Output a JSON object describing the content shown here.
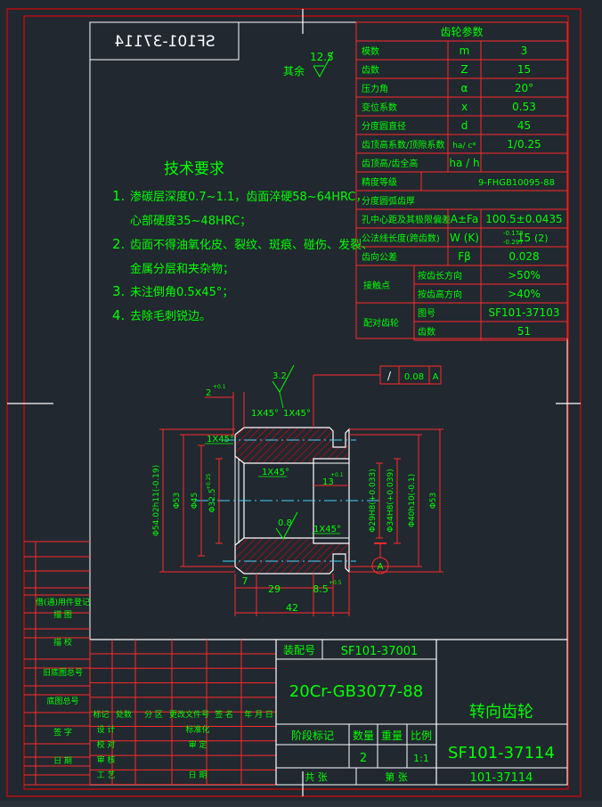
{
  "colors": {
    "background": "#212830",
    "border": "#ff0000",
    "line": "#ffffff",
    "text_green": "#00ff00",
    "table_red": "#ff2a2a",
    "center_line": "#3fd3ff",
    "hatch": "#ff0000"
  },
  "drawing_number_mirrored": "SF101-37114",
  "roughness": {
    "value": "12.5",
    "prefix": "其余"
  },
  "gear_table": {
    "title": "齿轮参数",
    "rows": [
      {
        "name": "模数",
        "sym": "m",
        "val": "3"
      },
      {
        "name": "齿数",
        "sym": "Z",
        "val": "15"
      },
      {
        "name": "压力角",
        "sym": "α",
        "val": "20°"
      },
      {
        "name": "变位系数",
        "sym": "x",
        "val": "0.53"
      },
      {
        "name": "分度圆直径",
        "sym": "d",
        "val": "45"
      },
      {
        "name": "齿顶高系数/顶隙系数",
        "sym": "ha/ c*",
        "val": "1/0.25"
      },
      {
        "name": "齿顶高/齿全高",
        "sym": "ha / h",
        "val": ""
      },
      {
        "name": "精度等级",
        "sym": "",
        "val": "9-FHGB10095-88"
      },
      {
        "name": "分度圆弧齿厚",
        "sym": "",
        "val": ""
      },
      {
        "name": "孔中心距及其极限偏差",
        "sym": "A±Fa",
        "val": "100.5±0.0435"
      },
      {
        "name": "公法线长度(跨齿数)",
        "sym": "W (K)",
        "val": "15"
      },
      {
        "name": "齿向公差",
        "sym": "Fβ",
        "val": "0.028"
      }
    ],
    "wk_tol_upper": "-0.178",
    "wk_tol_lower": "-0.297",
    "wk_k": "(2)",
    "contact_label": "接触点",
    "contact_rows": [
      {
        "name": "按齿长方向",
        "val": ">50%"
      },
      {
        "name": "按齿高方向",
        "val": ">40%"
      }
    ],
    "mate_label": "配对齿轮",
    "mate_rows": [
      {
        "name": "图号",
        "val": "SF101-37103"
      },
      {
        "name": "齿数",
        "val": "51"
      }
    ]
  },
  "tech_requirements": {
    "title": "技术要求",
    "items": [
      {
        "num": "1.",
        "text": "渗碳层深度0.7~1.1，齿面淬硬58~64HRC，"
      },
      {
        "num": "",
        "text": "心部硬度35~48HRC；"
      },
      {
        "num": "2.",
        "text": "齿面不得油氧化皮、裂纹、斑痕、碰伤、发裂、"
      },
      {
        "num": "",
        "text": "金属分层和夹杂物；"
      },
      {
        "num": "3.",
        "text": "未注倒角0.5x45°；"
      },
      {
        "num": "4.",
        "text": "去除毛刺锐边。"
      }
    ]
  },
  "dims": {
    "tolerance_frame": [
      "/",
      "0.08",
      "A"
    ],
    "rough_top": "3.2",
    "rough_bore": "0.8",
    "top_2": "2",
    "top_2_tol": "+0.1",
    "chamfer1": "1X45°",
    "chamfer2": "1X45°",
    "chamfer3": "1X45°",
    "chamfer4": "1X45°",
    "chamfer5": "1X45°",
    "d13": "13",
    "d13_tol": "+0.1",
    "phi54": "Φ54.02h11(-0.19)",
    "phi53a": "Φ53",
    "phi45": "Φ45",
    "phi32": "Φ32.5",
    "phi32_tol": "+0.25",
    "phi29": "Φ29H8(+0.033)",
    "phi34": "Φ34H8(+0.039)",
    "phi40": "Φ40h10(-0.1)",
    "phi53b": "Φ53",
    "d7": "7",
    "d29": "29",
    "d85": "8.5",
    "d85_tol": "+0.5",
    "d42": "42",
    "datum": "A"
  },
  "left_strip": {
    "rows": [
      "借(通)用件登记",
      "描 图",
      "描 校",
      "旧底图总号",
      "底图总号",
      "签 字",
      "日 期"
    ]
  },
  "title_block": {
    "assembly_label": "装配号",
    "assembly_no": "SF101-37001",
    "material": "20Cr-GB3077-88",
    "part_name": "转向齿轮",
    "drawing_no": "SF101-37114",
    "code_no": "101-37114",
    "rev_headers": [
      "标记",
      "处数",
      "分 区",
      "更改文件号",
      "签 名",
      "年 月 日"
    ],
    "sign_left": [
      "设 计",
      "校 对",
      "审 核",
      "工 艺"
    ],
    "sign_mid": [
      "标准化",
      "审 定",
      "",
      "日 期"
    ],
    "stage_label": "阶段标记",
    "qty_label": "数量",
    "weight_label": "重量",
    "scale_label": "比例",
    "qty": "2",
    "scale": "1:1",
    "total_label": "共  张",
    "sheet_label": "第  张"
  }
}
